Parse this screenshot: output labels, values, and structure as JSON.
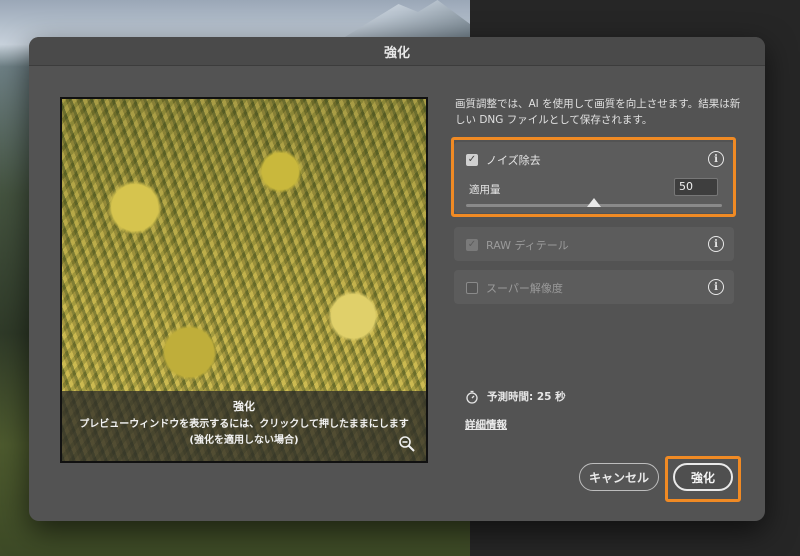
{
  "dialog": {
    "title": "強化",
    "description": "画質調整では、AI を使用して画質を向上させます。結果は新しい DNG ファイルとして保存されます。"
  },
  "preview": {
    "overlay_title": "強化",
    "overlay_line1": "プレビューウィンドウを表示するには、クリックして押したままにします",
    "overlay_line2": "(強化を適用しない場合)"
  },
  "options": {
    "noise": {
      "label": "ノイズ除去",
      "checked": true,
      "enabled": true,
      "amount_label": "適用量",
      "amount_value": "50",
      "slider_fraction": 0.5
    },
    "raw": {
      "label": "RAW ディテール",
      "checked": true,
      "enabled": false
    },
    "super": {
      "label": "スーパー解像度",
      "checked": false,
      "enabled": true
    }
  },
  "estimate": {
    "text": "予測時間: 25 秒"
  },
  "details_link": "詳細情報",
  "buttons": {
    "cancel": "キャンセル",
    "enhance": "強化"
  },
  "colors": {
    "highlight": "#f08a24",
    "dialog_bg": "#535353"
  }
}
